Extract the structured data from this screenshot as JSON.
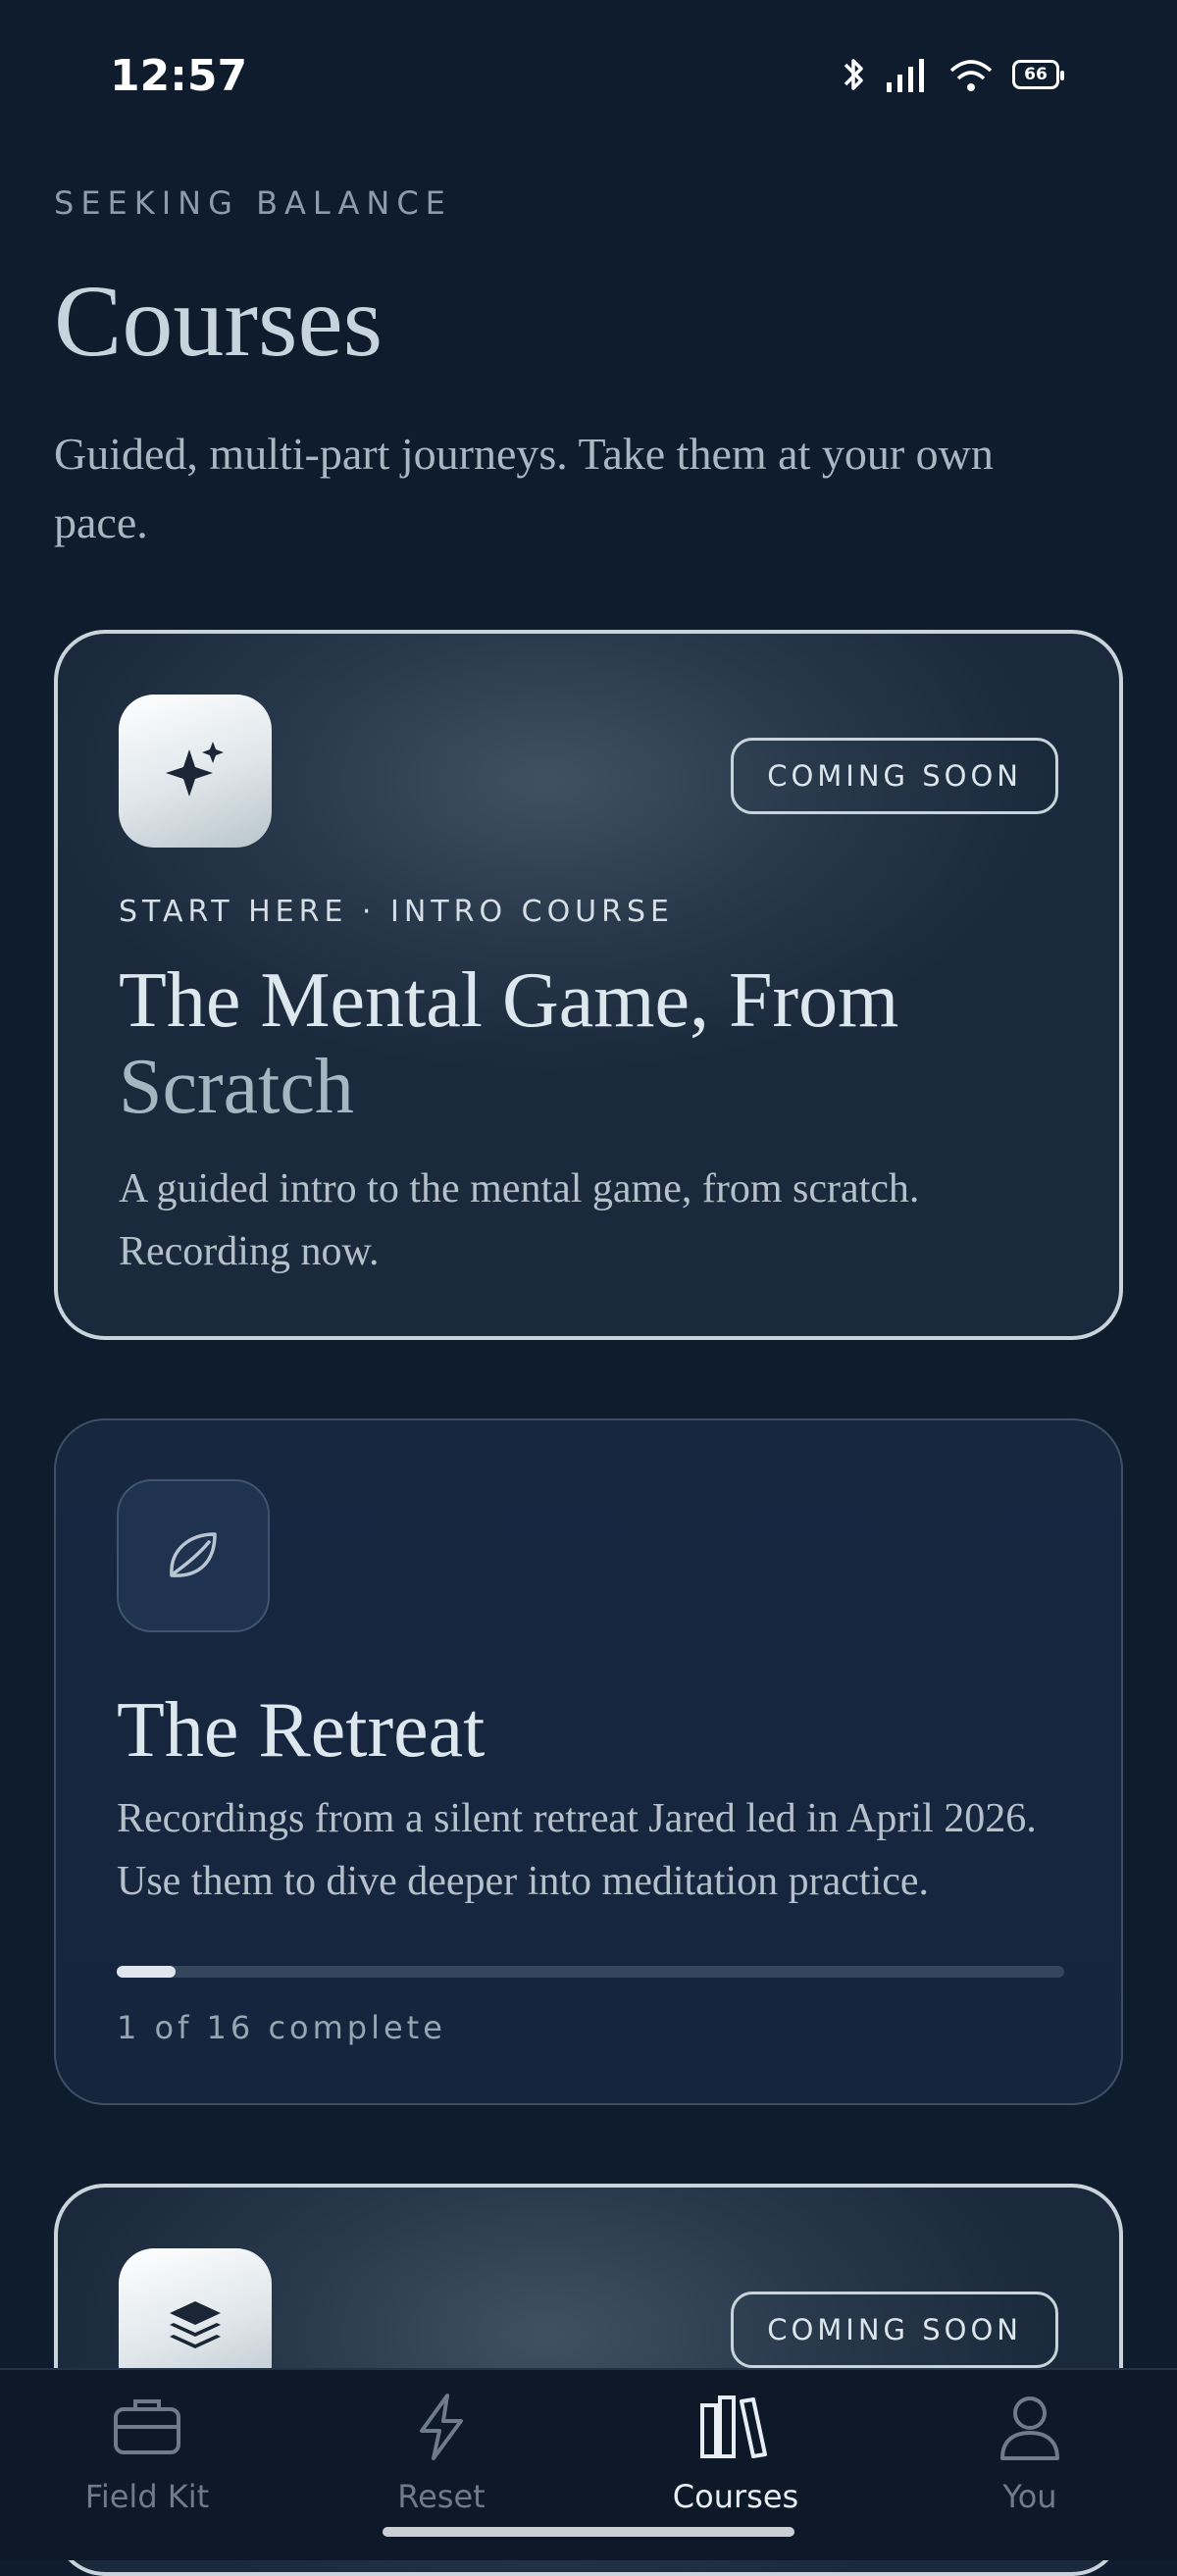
{
  "status_bar": {
    "time": "12:57",
    "battery": "66"
  },
  "header": {
    "eyebrow": "SEEKING BALANCE",
    "title": "Courses",
    "subtitle": "Guided, multi-part journeys. Take them at your own pace."
  },
  "courses": [
    {
      "icon": "sparkles-icon",
      "badge": "COMING SOON",
      "kicker": "START HERE · INTRO COURSE",
      "title_line1": "The Mental Game, From",
      "title_line2": "Scratch",
      "description": "A guided intro to the mental game, from scratch. Recording now."
    },
    {
      "icon": "leaf-icon",
      "title": "The Retreat",
      "description": "Recordings from a silent retreat Jared led in April 2026. Use them to dive deeper into meditation practice.",
      "progress_fraction": 0.0625,
      "progress_text": "1 of 16 complete"
    },
    {
      "icon": "layers-icon",
      "badge": "COMING SOON"
    }
  ],
  "nav": {
    "items": [
      {
        "label": "Field Kit",
        "icon": "briefcase-icon"
      },
      {
        "label": "Reset",
        "icon": "lightning-icon"
      },
      {
        "label": "Courses",
        "icon": "library-icon"
      },
      {
        "label": "You",
        "icon": "person-icon"
      }
    ],
    "active": "Courses"
  }
}
